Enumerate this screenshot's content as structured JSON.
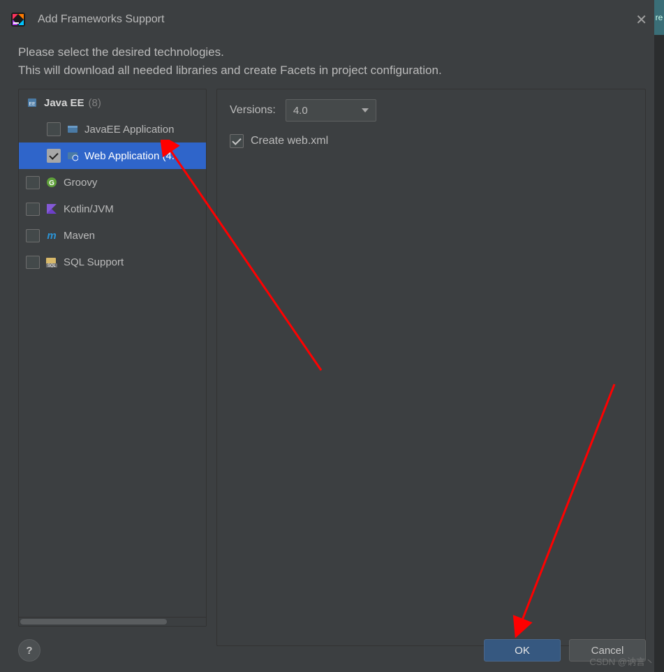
{
  "window": {
    "title": "Add Frameworks Support",
    "desc_line1": "Please select the desired technologies.",
    "desc_line2": "This will download all needed libraries and create Facets in project configuration."
  },
  "tree": {
    "parent": {
      "label": "Java EE",
      "count": "(8)"
    },
    "children": [
      {
        "label": "JavaEE Application",
        "checked": false,
        "selected": false,
        "icon": "javaee-app-icon"
      },
      {
        "label": "Web Application (4.",
        "checked": true,
        "selected": true,
        "icon": "web-app-icon"
      }
    ],
    "top_level": [
      {
        "label": "Groovy",
        "icon": "groovy-icon"
      },
      {
        "label": "Kotlin/JVM",
        "icon": "kotlin-icon"
      },
      {
        "label": "Maven",
        "icon": "maven-icon"
      },
      {
        "label": "SQL Support",
        "icon": "sql-icon"
      }
    ]
  },
  "details": {
    "versions_label": "Versions:",
    "versions_value": "4.0",
    "create_webxml_label": "Create web.xml",
    "create_webxml_checked": true
  },
  "footer": {
    "help": "?",
    "ok": "OK",
    "cancel": "Cancel"
  },
  "watermark": "CSDN @讷言丶",
  "cropped_letters": "re"
}
